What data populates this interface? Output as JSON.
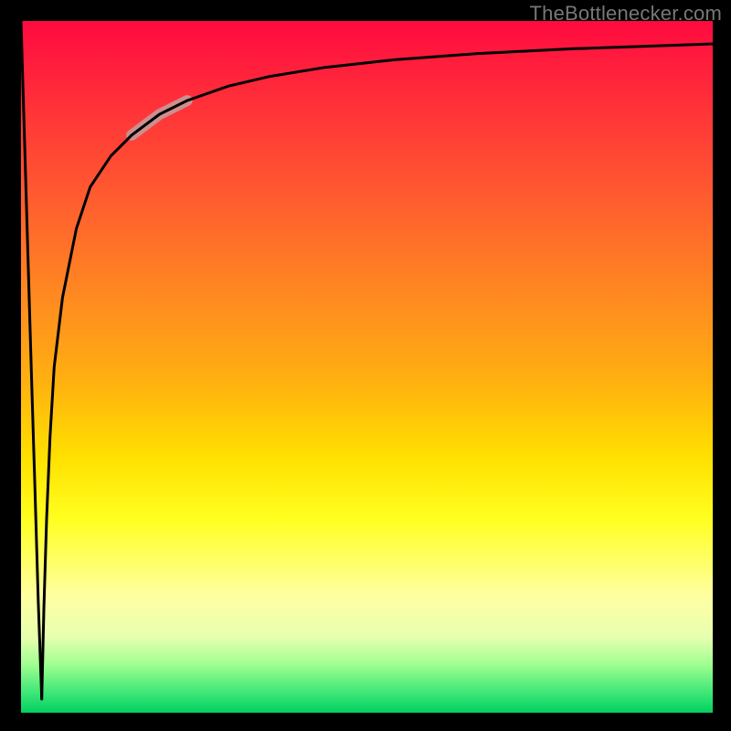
{
  "source_label": "TheBottlenecker.com",
  "colors": {
    "highlight_stroke": "#cc8f8f",
    "curve_stroke": "#000000"
  },
  "chart_data": {
    "type": "line",
    "title": "",
    "xlabel": "",
    "ylabel": "",
    "xlim": [
      0,
      100
    ],
    "ylim": [
      0,
      100
    ],
    "grid": false,
    "legend": false,
    "annotations": [],
    "series": [
      {
        "name": "left-drop",
        "x": [
          0.0,
          0.5,
          1.0,
          1.5,
          2.0,
          2.5,
          3.0
        ],
        "y": [
          100.0,
          83.0,
          66.0,
          49.0,
          33.0,
          16.0,
          2.0
        ]
      },
      {
        "name": "main-curve",
        "x": [
          3.0,
          3.3,
          3.7,
          4.2,
          4.8,
          6.0,
          8.0,
          10.0,
          13.0,
          16.0,
          20.0,
          24.0,
          30.0,
          36.0,
          44.0,
          54.0,
          66.0,
          80.0,
          100.0
        ],
        "y": [
          2.0,
          15.0,
          28.0,
          40.0,
          50.0,
          60.0,
          70.0,
          76.0,
          80.5,
          83.5,
          86.5,
          88.5,
          90.6,
          92.0,
          93.3,
          94.4,
          95.3,
          96.0,
          96.7
        ]
      },
      {
        "name": "highlight-segment",
        "x": [
          16.0,
          20.0,
          24.0
        ],
        "y": [
          83.5,
          86.5,
          88.5
        ]
      }
    ]
  }
}
